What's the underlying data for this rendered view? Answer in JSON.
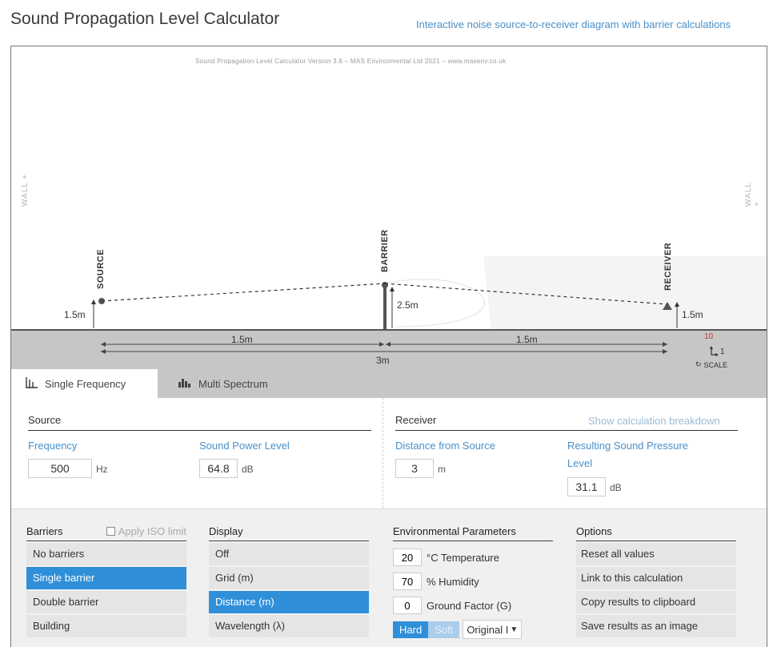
{
  "app": {
    "title": "Sound Propagation Level Calculator",
    "subtitle": "Interactive noise source-to-receiver diagram with barrier calculations"
  },
  "diagram": {
    "credit": "Sound Propagation Level Calculator Version 3.6 – MAS Environmental Ltd 2021 – www.masenv.co.uk",
    "wall_left": "WALL +",
    "wall_right": "WALL +",
    "source_label": "SOURCE",
    "barrier_label": "BARRIER",
    "receiver_label": "RECEIVER",
    "source_height": "1.5m",
    "barrier_height": "2.5m",
    "receiver_height": "1.5m",
    "dist_left": "1.5m",
    "dist_right": "1.5m",
    "dist_total": "3m",
    "scale_value": "10",
    "scale_unit": "1",
    "scale_label": "SCALE",
    "scale_icon": "refresh-icon",
    "colors": {
      "ground": "#c6c6c6",
      "accent": "#2f8fd8",
      "scale_red": "#cc3333"
    }
  },
  "tabs": [
    {
      "label": "Single Frequency",
      "icon": "bar-chart-icon",
      "active": true
    },
    {
      "label": "Multi Spectrum",
      "icon": "spectrum-icon",
      "active": false
    }
  ],
  "source": {
    "heading": "Source",
    "frequency_label": "Frequency",
    "frequency_value": "500",
    "frequency_unit": "Hz",
    "power_label": "Sound Power Level",
    "power_value": "64.8",
    "power_unit": "dB"
  },
  "receiver": {
    "heading": "Receiver",
    "breakdown_link": "Show calculation breakdown",
    "distance_label": "Distance from Source",
    "distance_value": "3",
    "distance_unit": "m",
    "spl_label_1": "Resulting Sound Pressure",
    "spl_label_2": "Level",
    "spl_value": "31.1",
    "spl_unit": "dB"
  },
  "barriers": {
    "heading": "Barriers",
    "iso_label": "Apply ISO limit",
    "items": [
      "No barriers",
      "Single barrier",
      "Double barrier",
      "Building"
    ],
    "selected": 1
  },
  "display": {
    "heading": "Display",
    "items": [
      "Off",
      "Grid (m)",
      "Distance (m)",
      "Wavelength (λ)"
    ],
    "selected": 2
  },
  "environment": {
    "heading": "Environmental Parameters",
    "temperature_value": "20",
    "temperature_label": "°C Temperature",
    "humidity_value": "70",
    "humidity_label": "% Humidity",
    "ground_value": "0",
    "ground_label": "Ground Factor (G)",
    "hard_label": "Hard",
    "soft_label": "Soft",
    "select_value": "Original I"
  },
  "options": {
    "heading": "Options",
    "items": [
      "Reset all values",
      "Link to this calculation",
      "Copy results to clipboard",
      "Save results as an image"
    ]
  }
}
